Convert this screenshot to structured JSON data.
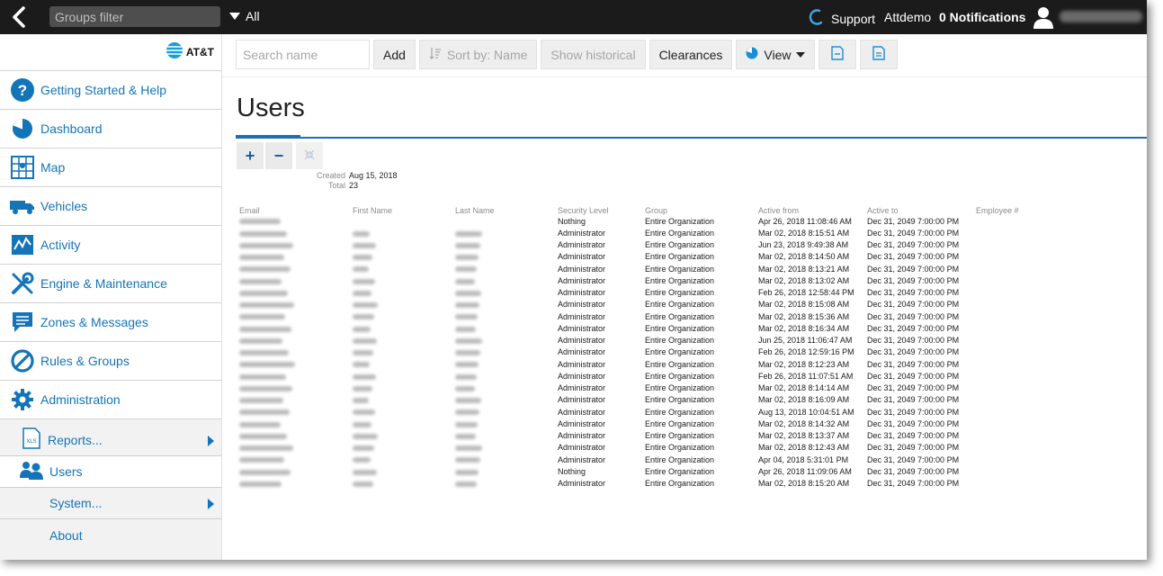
{
  "topbar": {
    "groups_filter_placeholder": "Groups filter",
    "all_label": "All",
    "support_label": "Support",
    "user_name": "Attdemo",
    "notifications_label": "0 Notifications"
  },
  "brand": {
    "logo_text": "AT&T"
  },
  "sidebar": {
    "items": [
      {
        "label": "Getting Started & Help",
        "icon": "help-icon"
      },
      {
        "label": "Dashboard",
        "icon": "dashboard-pie-icon"
      },
      {
        "label": "Map",
        "icon": "map-icon"
      },
      {
        "label": "Vehicles",
        "icon": "vehicle-truck-icon"
      },
      {
        "label": "Activity",
        "icon": "activity-chart-icon"
      },
      {
        "label": "Engine & Maintenance",
        "icon": "wrench-icon"
      },
      {
        "label": "Zones & Messages",
        "icon": "message-icon"
      },
      {
        "label": "Rules & Groups",
        "icon": "prohibition-icon"
      },
      {
        "label": "Administration",
        "icon": "gear-icon"
      }
    ],
    "sub_items": [
      {
        "label": "Reports...",
        "icon": "xls-icon"
      },
      {
        "label": "Users",
        "icon": "users-icon"
      },
      {
        "label": "System..."
      },
      {
        "label": "About"
      }
    ]
  },
  "toolbar": {
    "search_placeholder": "Search name",
    "add_label": "Add",
    "sort_label": "Sort by: Name",
    "historical_label": "Show historical",
    "clearances_label": "Clearances",
    "view_label": "View"
  },
  "page": {
    "title": "Users",
    "created_label": "Created",
    "created_value": "Aug 15, 2018",
    "total_label": "Total",
    "total_value": "23"
  },
  "table": {
    "columns": [
      "Email",
      "First Name",
      "Last Name",
      "Security Level",
      "Group",
      "Active from",
      "Active to",
      "Employee #"
    ],
    "rows": [
      {
        "security": "Nothing",
        "group": "Entire Organization",
        "from": "Apr 26, 2018 11:08:46 AM",
        "to": "Dec 31, 2049 7:00:00 PM"
      },
      {
        "security": "Administrator",
        "group": "Entire Organization",
        "from": "Mar 02, 2018 8:15:51 AM",
        "to": "Dec 31, 2049 7:00:00 PM"
      },
      {
        "security": "Administrator",
        "group": "Entire Organization",
        "from": "Jun 23, 2018 9:49:38 AM",
        "to": "Dec 31, 2049 7:00:00 PM"
      },
      {
        "security": "Administrator",
        "group": "Entire Organization",
        "from": "Mar 02, 2018 8:14:50 AM",
        "to": "Dec 31, 2049 7:00:00 PM"
      },
      {
        "security": "Administrator",
        "group": "Entire Organization",
        "from": "Mar 02, 2018 8:13:21 AM",
        "to": "Dec 31, 2049 7:00:00 PM"
      },
      {
        "security": "Administrator",
        "group": "Entire Organization",
        "from": "Mar 02, 2018 8:13:02 AM",
        "to": "Dec 31, 2049 7:00:00 PM"
      },
      {
        "security": "Administrator",
        "group": "Entire Organization",
        "from": "Feb 26, 2018 12:58:44 PM",
        "to": "Dec 31, 2049 7:00:00 PM"
      },
      {
        "security": "Administrator",
        "group": "Entire Organization",
        "from": "Mar 02, 2018 8:15:08 AM",
        "to": "Dec 31, 2049 7:00:00 PM"
      },
      {
        "security": "Administrator",
        "group": "Entire Organization",
        "from": "Mar 02, 2018 8:15:36 AM",
        "to": "Dec 31, 2049 7:00:00 PM"
      },
      {
        "security": "Administrator",
        "group": "Entire Organization",
        "from": "Mar 02, 2018 8:16:34 AM",
        "to": "Dec 31, 2049 7:00:00 PM"
      },
      {
        "security": "Administrator",
        "group": "Entire Organization",
        "from": "Jun 25, 2018 11:06:47 AM",
        "to": "Dec 31, 2049 7:00:00 PM"
      },
      {
        "security": "Administrator",
        "group": "Entire Organization",
        "from": "Feb 26, 2018 12:59:16 PM",
        "to": "Dec 31, 2049 7:00:00 PM"
      },
      {
        "security": "Administrator",
        "group": "Entire Organization",
        "from": "Mar 02, 2018 8:12:23 AM",
        "to": "Dec 31, 2049 7:00:00 PM"
      },
      {
        "security": "Administrator",
        "group": "Entire Organization",
        "from": "Feb 26, 2018 11:07:51 AM",
        "to": "Dec 31, 2049 7:00:00 PM"
      },
      {
        "security": "Administrator",
        "group": "Entire Organization",
        "from": "Mar 02, 2018 8:14:14 AM",
        "to": "Dec 31, 2049 7:00:00 PM"
      },
      {
        "security": "Administrator",
        "group": "Entire Organization",
        "from": "Mar 02, 2018 8:16:09 AM",
        "to": "Dec 31, 2049 7:00:00 PM"
      },
      {
        "security": "Administrator",
        "group": "Entire Organization",
        "from": "Aug 13, 2018 10:04:51 AM",
        "to": "Dec 31, 2049 7:00:00 PM"
      },
      {
        "security": "Administrator",
        "group": "Entire Organization",
        "from": "Mar 02, 2018 8:14:32 AM",
        "to": "Dec 31, 2049 7:00:00 PM"
      },
      {
        "security": "Administrator",
        "group": "Entire Organization",
        "from": "Mar 02, 2018 8:13:37 AM",
        "to": "Dec 31, 2049 7:00:00 PM"
      },
      {
        "security": "Administrator",
        "group": "Entire Organization",
        "from": "Mar 02, 2018 8:12:43 AM",
        "to": "Dec 31, 2049 7:00:00 PM"
      },
      {
        "security": "Administrator",
        "group": "Entire Organization",
        "from": "Apr 04, 2018 5:31:01 PM",
        "to": "Dec 31, 2049 7:00:00 PM"
      },
      {
        "security": "Nothing",
        "group": "Entire Organization",
        "from": "Apr 26, 2018 11:09:06 AM",
        "to": "Dec 31, 2049 7:00:00 PM"
      },
      {
        "security": "Administrator",
        "group": "Entire Organization",
        "from": "Mar 02, 2018 8:15:20 AM",
        "to": "Dec 31, 2049 7:00:00 PM"
      }
    ]
  },
  "colors": {
    "accent": "#1474b8",
    "topbar": "#1b1b1b",
    "title_rule": "#1f6db5"
  }
}
